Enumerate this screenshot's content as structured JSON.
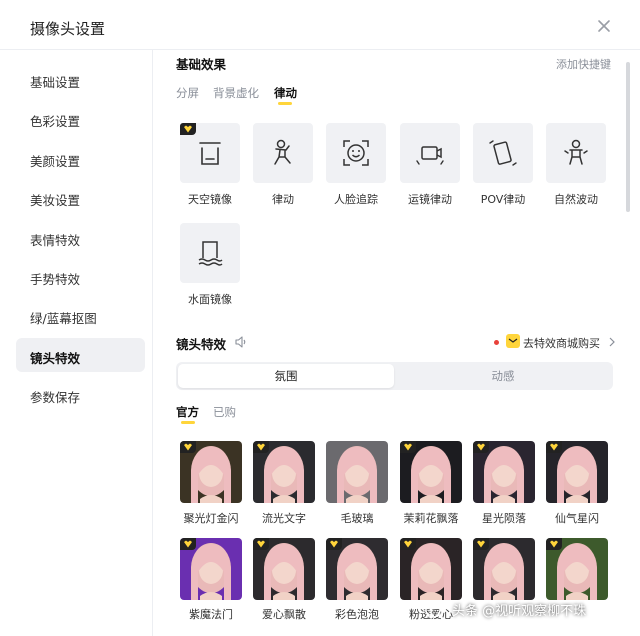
{
  "window": {
    "title": "摄像头设置",
    "close_icon": "close-icon"
  },
  "sidebar": {
    "items": [
      {
        "label": "基础设置",
        "active": false
      },
      {
        "label": "色彩设置",
        "active": false
      },
      {
        "label": "美颜设置",
        "active": false
      },
      {
        "label": "美妆设置",
        "active": false
      },
      {
        "label": "表情特效",
        "active": false
      },
      {
        "label": "手势特效",
        "active": false
      },
      {
        "label": "绿/蓝幕抠图",
        "active": false
      },
      {
        "label": "镜头特效",
        "active": true
      },
      {
        "label": "参数保存",
        "active": false
      }
    ]
  },
  "basic_effects": {
    "title": "基础效果",
    "shortcut_link": "添加快捷键",
    "tabs": [
      {
        "label": "分屏",
        "active": false
      },
      {
        "label": "背景虚化",
        "active": false
      },
      {
        "label": "律动",
        "active": true
      }
    ],
    "items": [
      {
        "label": "天空镜像",
        "icon": "sky-mirror-icon",
        "vip": true
      },
      {
        "label": "律动",
        "icon": "rhythm-figure-icon",
        "vip": false
      },
      {
        "label": "人脸追踪",
        "icon": "face-tracking-icon",
        "vip": false
      },
      {
        "label": "运镜律动",
        "icon": "camera-move-icon",
        "vip": false
      },
      {
        "label": "POV律动",
        "icon": "pov-icon",
        "vip": false
      },
      {
        "label": "自然波动",
        "icon": "natural-wave-icon",
        "vip": false
      },
      {
        "label": "水面镜像",
        "icon": "water-mirror-icon",
        "vip": false
      }
    ]
  },
  "lens_effects": {
    "title": "镜头特效",
    "sound_icon": "speaker-icon",
    "shop_link": "去特效商城购买",
    "segments": [
      {
        "label": "氛围",
        "active": true
      },
      {
        "label": "动感",
        "active": false
      }
    ],
    "tabs": [
      {
        "label": "官方",
        "active": true
      },
      {
        "label": "已购",
        "active": false
      }
    ],
    "items": [
      {
        "label": "聚光灯金闪",
        "vip": true,
        "bg": "#3b3324"
      },
      {
        "label": "流光文字",
        "vip": true,
        "bg": "#2b2b2f"
      },
      {
        "label": "毛玻璃",
        "vip": false,
        "bg": "#6b6a6e"
      },
      {
        "label": "茉莉花飘落",
        "vip": true,
        "bg": "#1c1c20"
      },
      {
        "label": "星光陨落",
        "vip": true,
        "bg": "#2a2530"
      },
      {
        "label": "仙气星闪",
        "vip": true,
        "bg": "#25242a"
      },
      {
        "label": "紫魔法门",
        "vip": true,
        "bg": "#6a2fb0"
      },
      {
        "label": "爱心飘散",
        "vip": true,
        "bg": "#2c2a2d"
      },
      {
        "label": "彩色泡泡",
        "vip": true,
        "bg": "#2e2c30"
      },
      {
        "label": "粉透爱心",
        "vip": true,
        "bg": "#2a2426"
      },
      {
        "label": "",
        "vip": true,
        "bg": "#2c2a2e"
      },
      {
        "label": "",
        "vip": true,
        "bg": "#3d5a2c"
      }
    ]
  },
  "watermark": {
    "text": "头条 @视听观察柳不珠"
  },
  "colors": {
    "accent": "#ffd53b",
    "active_nav_bg": "#eff0f3",
    "tile_bg": "#f0f1f4",
    "dot": "#e8413a"
  }
}
